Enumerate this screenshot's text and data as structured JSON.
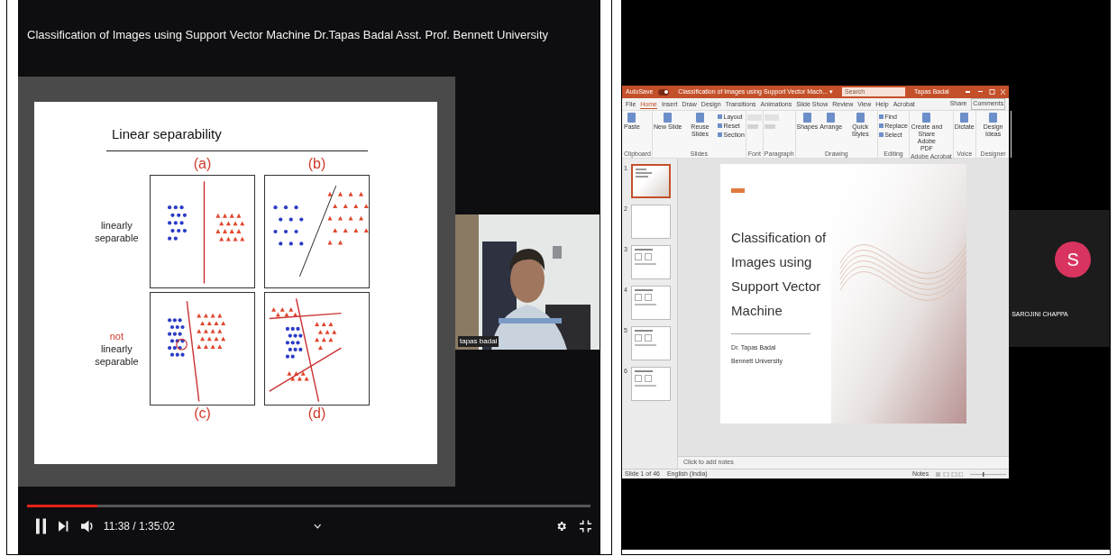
{
  "video_player": {
    "title": "Classification of Images using Support Vector Machine Dr.Tapas Badal Asst. Prof. Bennett University",
    "slide": {
      "heading": "Linear separability",
      "panel_labels": [
        "(a)",
        "(b)",
        "(c)",
        "(d)"
      ],
      "rows": [
        {
          "label": [
            {
              "text": "linearly",
              "kind": "printed"
            },
            {
              "text": "separable",
              "kind": "printed"
            }
          ]
        },
        {
          "label": [
            {
              "text": "not",
              "kind": "annotation"
            },
            {
              "text": "linearly",
              "kind": "printed"
            },
            {
              "text": "separable",
              "kind": "printed"
            }
          ]
        }
      ]
    },
    "webcam": {
      "kind": "picture",
      "name": "tapas badal"
    },
    "controls": {
      "progress": {
        "level": 0.125
      },
      "time": "11:38 / 1:35:02"
    }
  },
  "meeting": {
    "powerpoint": {
      "autosave": "AutoSave",
      "autosave_on": true,
      "doc_title": "Classification of Images using Support Vector Mach... ▾",
      "search": {
        "placeholder": "Search"
      },
      "user": "Tapas Badal",
      "tabs": [
        {
          "label": "File",
          "selected": false
        },
        {
          "label": "Home",
          "selected": true
        },
        {
          "label": "Insert",
          "selected": false
        },
        {
          "label": "Draw",
          "selected": false
        },
        {
          "label": "Design",
          "selected": false
        },
        {
          "label": "Transitions",
          "selected": false
        },
        {
          "label": "Animations",
          "selected": false
        },
        {
          "label": "Slide Show",
          "selected": false
        },
        {
          "label": "Review",
          "selected": false
        },
        {
          "label": "View",
          "selected": false
        },
        {
          "label": "Help",
          "selected": false
        },
        {
          "label": "Acrobat",
          "selected": false
        }
      ],
      "share": "Share",
      "comments": "Comments",
      "ribbon_groups": [
        {
          "label": "Clipboard",
          "buttons": [
            {
              "label": "Paste",
              "kind": "large"
            }
          ]
        },
        {
          "label": "Slides",
          "buttons": [
            {
              "label": "New Slide",
              "kind": "large"
            },
            {
              "label": "Reuse Slides",
              "kind": "large"
            },
            {
              "label": "Layout",
              "kind": "small"
            },
            {
              "label": "Reset",
              "kind": "small"
            },
            {
              "label": "Section",
              "kind": "small"
            }
          ]
        },
        {
          "label": "Font"
        },
        {
          "label": "Paragraph"
        },
        {
          "label": "Drawing",
          "buttons": [
            {
              "label": "Shapes",
              "kind": "large"
            },
            {
              "label": "Arrange",
              "kind": "large"
            },
            {
              "label": "Quick Styles",
              "kind": "large"
            }
          ]
        },
        {
          "label": "Editing",
          "buttons": [
            {
              "label": "Find",
              "kind": "small"
            },
            {
              "label": "Replace",
              "kind": "small"
            },
            {
              "label": "Select",
              "kind": "small"
            }
          ]
        },
        {
          "label": "Adobe Acrobat",
          "buttons": [
            {
              "label": "Create and Share Adobe PDF",
              "kind": "large"
            }
          ]
        },
        {
          "label": "Voice",
          "buttons": [
            {
              "label": "Dictate",
              "kind": "large"
            }
          ]
        },
        {
          "label": "Designer",
          "buttons": [
            {
              "label": "Design Ideas",
              "kind": "large"
            }
          ]
        }
      ],
      "thumbnails": [
        {
          "number": "1",
          "kind": "title",
          "selected": true
        },
        {
          "number": "2",
          "kind": "blank",
          "selected": false
        },
        {
          "number": "3",
          "kind": "content",
          "selected": false
        },
        {
          "number": "4",
          "kind": "content",
          "selected": false
        },
        {
          "number": "5",
          "kind": "content",
          "selected": false
        },
        {
          "number": "6",
          "kind": "content",
          "selected": false
        }
      ],
      "slide": {
        "title": "Classification of Images using Support Vector Machine",
        "author": "Dr. Tapas Badal",
        "affiliation": "Bennett University"
      },
      "notes": {
        "placeholder": "Click to add notes"
      },
      "status_bar": {
        "slide_count": "Slide 1 of 46",
        "language": "English (India)",
        "notes": "Notes"
      }
    },
    "participant": {
      "initial": "S",
      "name": "SAROJINI CHAPPA",
      "color": "#d8345f"
    }
  }
}
